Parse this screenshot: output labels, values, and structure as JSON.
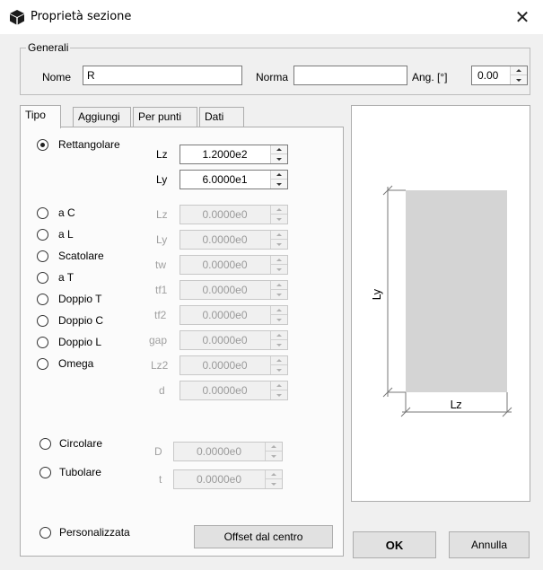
{
  "window": {
    "title": "Proprietà sezione",
    "close_glyph": "✕",
    "icon": "cube-icon"
  },
  "generali": {
    "legend": "Generali",
    "nome_label": "Nome",
    "nome_value": "R",
    "norma_label": "Norma",
    "norma_value": "",
    "ang_label": "Ang. [°]",
    "ang_value": "0.00"
  },
  "tabs": [
    {
      "label": "Tipo",
      "active": true
    },
    {
      "label": "Aggiungi",
      "active": false
    },
    {
      "label": "Per punti",
      "active": false
    },
    {
      "label": "Dati",
      "active": false
    }
  ],
  "section_types": {
    "rettangolare": {
      "label": "Rettangolare",
      "checked": true
    },
    "a_c": {
      "label": "a C"
    },
    "a_l": {
      "label": "a L"
    },
    "scatolare": {
      "label": "Scatolare"
    },
    "a_t": {
      "label": "a T"
    },
    "doppio_t": {
      "label": "Doppio T"
    },
    "doppio_c": {
      "label": "Doppio C"
    },
    "doppio_l": {
      "label": "Doppio L"
    },
    "omega": {
      "label": "Omega"
    },
    "circolare": {
      "label": "Circolare"
    },
    "tubolare": {
      "label": "Tubolare"
    },
    "personalizzata": {
      "label": "Personalizzata"
    }
  },
  "rect_params": [
    {
      "label": "Lz",
      "value": "1.2000e2"
    },
    {
      "label": "Ly",
      "value": "6.0000e1"
    }
  ],
  "profile_params": [
    {
      "label": "Lz",
      "value": "0.0000e0"
    },
    {
      "label": "Ly",
      "value": "0.0000e0"
    },
    {
      "label": "tw",
      "value": "0.0000e0"
    },
    {
      "label": "tf1",
      "value": "0.0000e0"
    },
    {
      "label": "tf2",
      "value": "0.0000e0"
    },
    {
      "label": "gap",
      "value": "0.0000e0"
    },
    {
      "label": "Lz2",
      "value": "0.0000e0"
    },
    {
      "label": "d",
      "value": "0.0000e0"
    }
  ],
  "circ_params": [
    {
      "label": "D",
      "value": "0.0000e0"
    },
    {
      "label": "t",
      "value": "0.0000e0"
    }
  ],
  "buttons": {
    "offset": "Offset dal centro",
    "ok": "OK",
    "annulla": "Annulla"
  },
  "preview": {
    "dim_vertical": "Ly",
    "dim_horizontal": "Lz",
    "fill_color": "#d4d4d4"
  }
}
